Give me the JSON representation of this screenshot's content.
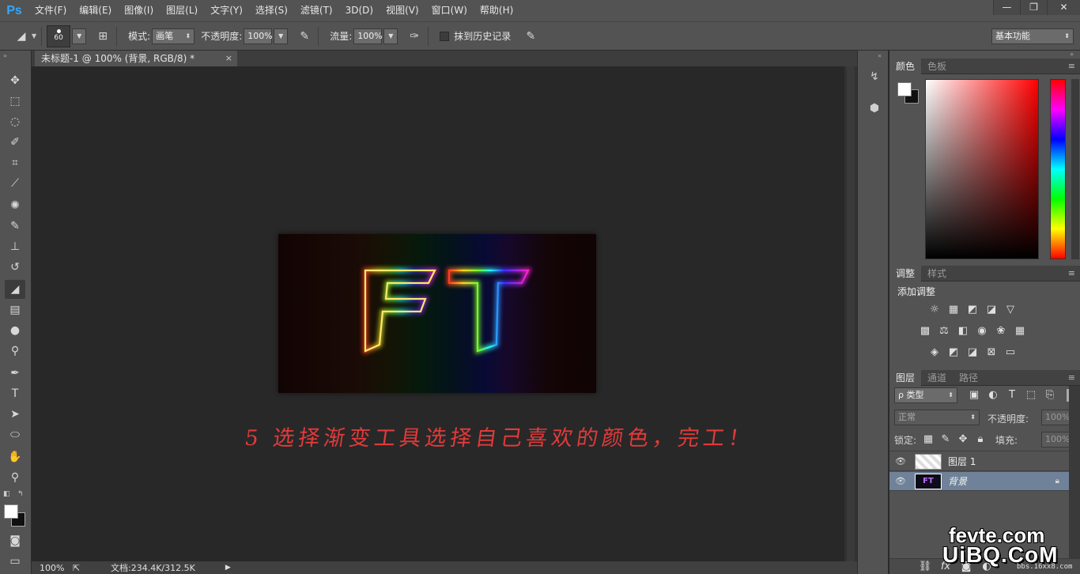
{
  "app": {
    "logo": "Ps",
    "menu": [
      "文件(F)",
      "编辑(E)",
      "图像(I)",
      "图层(L)",
      "文字(Y)",
      "选择(S)",
      "滤镜(T)",
      "3D(D)",
      "视图(V)",
      "窗口(W)",
      "帮助(H)"
    ],
    "window_controls": [
      "—",
      "❐",
      "✕"
    ]
  },
  "options": {
    "brush_size": "60",
    "mode_label": "模式:",
    "mode_value": "画笔",
    "opacity_label": "不透明度:",
    "opacity_value": "100%",
    "flow_label": "流量:",
    "flow_value": "100%",
    "erase_history_label": "抹到历史记录",
    "workspace": "基本功能"
  },
  "document": {
    "tab_title": "未标题-1 @ 100% (背景, RGB/8) *",
    "tab_close": "×",
    "zoom": "100%",
    "doc_info": "文档:234.4K/312.5K",
    "artwork_text": "FT",
    "instruction": "5 选择渐变工具选择自己喜欢的颜色，完工！"
  },
  "panels": {
    "color_tabs": [
      "颜色",
      "色板"
    ],
    "adjust_tabs": [
      "调整",
      "样式"
    ],
    "adjust_title": "添加调整",
    "layers_tabs": [
      "图层",
      "通道",
      "路径"
    ],
    "filter_kind": "ρ 类型",
    "blend_mode": "正常",
    "opacity_label": "不透明度:",
    "opacity_value": "100%",
    "lock_label": "锁定:",
    "fill_label": "填充:",
    "fill_value": "100%",
    "layers": [
      {
        "name": "图层 1",
        "selected": false
      },
      {
        "name": "背景",
        "selected": true
      }
    ]
  },
  "watermark": {
    "line1": "fevte.com",
    "line2": "UiBQ.CoM",
    "line3": "bbs.16xx8.com"
  },
  "colors": {
    "menubar": "#535353",
    "canvas_bg": "#282828",
    "instruction_red": "#e23a3a",
    "selected_layer": "#6f8299"
  }
}
